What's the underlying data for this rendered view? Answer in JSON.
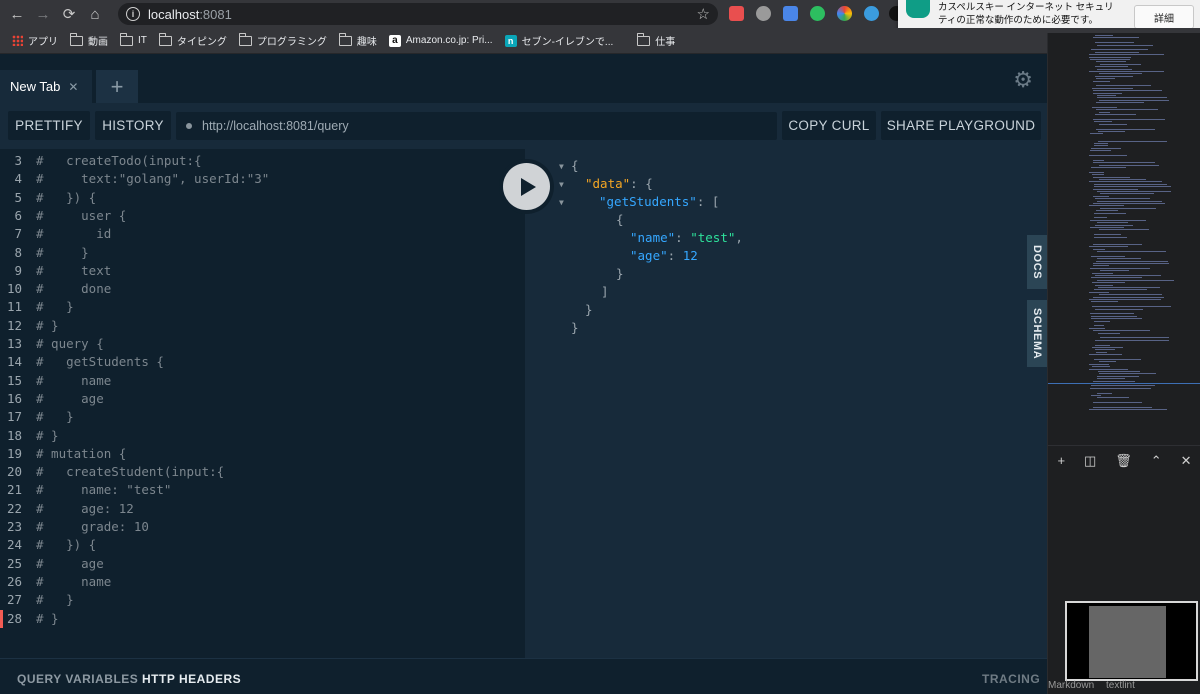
{
  "browser": {
    "url_host": "localhost",
    "url_port": ":8081",
    "notification": {
      "message": "カスペルスキー インターネット セキュリティの正常な動作のために必要です。",
      "button": "詳細"
    },
    "bookmarks": [
      {
        "label": "アプリ",
        "icon": "apps-icon"
      },
      {
        "label": "動画",
        "icon": "folder-icon"
      },
      {
        "label": "IT",
        "icon": "folder-icon"
      },
      {
        "label": "タイピング",
        "icon": "folder-icon"
      },
      {
        "label": "プログラミング",
        "icon": "folder-icon"
      },
      {
        "label": "趣味",
        "icon": "folder-icon"
      },
      {
        "label": "Amazon.co.jp: Pri...",
        "icon": "amazon-icon"
      },
      {
        "label": "セブン-イレブンで...",
        "icon": "seven-eleven-icon"
      },
      {
        "label": "仕事",
        "icon": "folder-icon"
      }
    ]
  },
  "playground": {
    "tab_label": "New Tab",
    "toolbar": {
      "prettify": "PRETTIFY",
      "history": "HISTORY",
      "endpoint": "http://localhost:8081/query",
      "copy_curl": "COPY CURL",
      "share": "SHARE PLAYGROUND"
    },
    "side_tabs": {
      "docs": "DOCS",
      "schema": "SCHEMA"
    },
    "bottom": {
      "query_variables": "QUERY VARIABLES",
      "http_headers": "HTTP HEADERS",
      "tracing": "TRACING"
    },
    "editor_lines": [
      {
        "n": "3",
        "text": "#   createTodo(input:{"
      },
      {
        "n": "4",
        "text": "#     text:\"golang\", userId:\"3\""
      },
      {
        "n": "5",
        "text": "#   }) {"
      },
      {
        "n": "6",
        "text": "#     user {"
      },
      {
        "n": "7",
        "text": "#       id"
      },
      {
        "n": "8",
        "text": "#     }"
      },
      {
        "n": "9",
        "text": "#     text"
      },
      {
        "n": "10",
        "text": "#     done"
      },
      {
        "n": "11",
        "text": "#   }"
      },
      {
        "n": "12",
        "text": "# }"
      },
      {
        "n": "13",
        "text": "# query {"
      },
      {
        "n": "14",
        "text": "#   getStudents {"
      },
      {
        "n": "15",
        "text": "#     name"
      },
      {
        "n": "16",
        "text": "#     age"
      },
      {
        "n": "17",
        "text": "#   }"
      },
      {
        "n": "18",
        "text": "# }"
      },
      {
        "n": "19",
        "text": "# mutation {"
      },
      {
        "n": "20",
        "text": "#   createStudent(input:{"
      },
      {
        "n": "21",
        "text": "#     name: \"test\""
      },
      {
        "n": "22",
        "text": "#     age: 12"
      },
      {
        "n": "23",
        "text": "#     grade: 10"
      },
      {
        "n": "24",
        "text": "#   }) {"
      },
      {
        "n": "25",
        "text": "#     age"
      },
      {
        "n": "26",
        "text": "#     name"
      },
      {
        "n": "27",
        "text": "#   }"
      },
      {
        "n": "28",
        "text": "# }"
      }
    ],
    "result": {
      "brace_open": "{",
      "data_key": "\"data\"",
      "students_key": "\"getStudents\"",
      "name_key": "\"name\"",
      "name_value": "\"test\"",
      "age_key": "\"age\"",
      "age_value": "12"
    }
  },
  "sidepane": {
    "status_left": "Markdown",
    "status_right": "textlint"
  },
  "colors": {
    "accent_orange": "#f5a623",
    "key_blue": "#35a7ff",
    "string_green": "#2ee19b",
    "marker_red": "#f25c54"
  }
}
